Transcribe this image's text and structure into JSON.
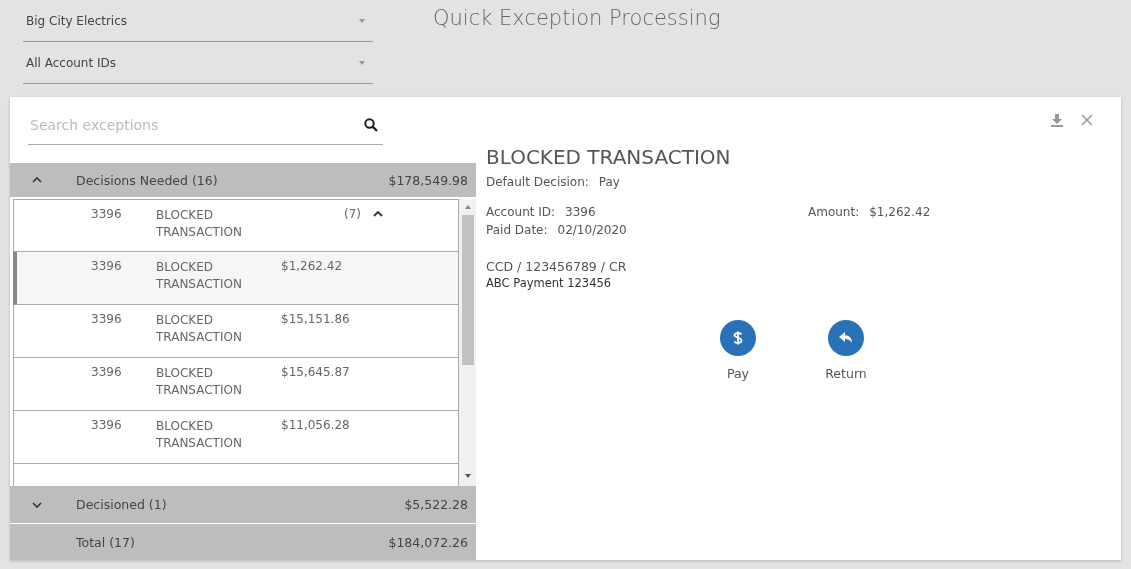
{
  "filters": [
    {
      "value": "Big City Electrics"
    },
    {
      "value": "All Account IDs"
    }
  ],
  "page_title": "Quick Exception Processing",
  "search": {
    "placeholder": "Search exceptions"
  },
  "groups": [
    {
      "label": "Decisions Needed (16)",
      "total": "$178,549.98",
      "expanded": true,
      "rows": [
        {
          "kind": "group",
          "account": "3396",
          "type": "BLOCKED TRANSACTION",
          "count": "(7)",
          "expanded": true,
          "selected": false
        },
        {
          "kind": "item",
          "account": "3396",
          "type": "BLOCKED TRANSACTION",
          "amount": "$1,262.42",
          "selected": true
        },
        {
          "kind": "item",
          "account": "3396",
          "type": "BLOCKED TRANSACTION",
          "amount": "$15,151.86",
          "selected": false
        },
        {
          "kind": "item",
          "account": "3396",
          "type": "BLOCKED TRANSACTION",
          "amount": "$15,645.87",
          "selected": false
        },
        {
          "kind": "item",
          "account": "3396",
          "type": "BLOCKED TRANSACTION",
          "amount": "$11,056.28",
          "selected": false
        },
        {
          "kind": "partial"
        }
      ]
    },
    {
      "label": "Decisioned (1)",
      "total": "$5,522.28",
      "expanded": false
    }
  ],
  "total": {
    "label": "Total (17)",
    "amount": "$184,072.26"
  },
  "detail": {
    "title": "BLOCKED TRANSACTION",
    "default_decision": {
      "label": "Default Decision:",
      "value": "Pay"
    },
    "account_id": {
      "label": "Account ID:",
      "value": "3396"
    },
    "amount": {
      "label": "Amount:",
      "value": "$1,262.42"
    },
    "paid_date": {
      "label": "Paid Date:",
      "value": "02/10/2020"
    },
    "reference": "CCD / 123456789 / CR",
    "description": "ABC Payment 123456",
    "actions": [
      {
        "kind": "pay",
        "label": "Pay"
      },
      {
        "kind": "return",
        "label": "Return"
      }
    ]
  }
}
